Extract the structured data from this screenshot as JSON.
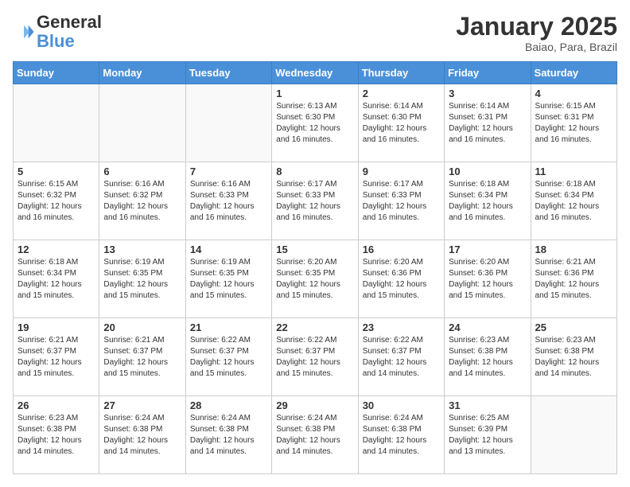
{
  "header": {
    "logo_line1": "General",
    "logo_line2": "Blue",
    "month": "January 2025",
    "location": "Baiao, Para, Brazil"
  },
  "weekdays": [
    "Sunday",
    "Monday",
    "Tuesday",
    "Wednesday",
    "Thursday",
    "Friday",
    "Saturday"
  ],
  "weeks": [
    [
      {
        "day": "",
        "info": ""
      },
      {
        "day": "",
        "info": ""
      },
      {
        "day": "",
        "info": ""
      },
      {
        "day": "1",
        "info": "Sunrise: 6:13 AM\nSunset: 6:30 PM\nDaylight: 12 hours\nand 16 minutes."
      },
      {
        "day": "2",
        "info": "Sunrise: 6:14 AM\nSunset: 6:30 PM\nDaylight: 12 hours\nand 16 minutes."
      },
      {
        "day": "3",
        "info": "Sunrise: 6:14 AM\nSunset: 6:31 PM\nDaylight: 12 hours\nand 16 minutes."
      },
      {
        "day": "4",
        "info": "Sunrise: 6:15 AM\nSunset: 6:31 PM\nDaylight: 12 hours\nand 16 minutes."
      }
    ],
    [
      {
        "day": "5",
        "info": "Sunrise: 6:15 AM\nSunset: 6:32 PM\nDaylight: 12 hours\nand 16 minutes."
      },
      {
        "day": "6",
        "info": "Sunrise: 6:16 AM\nSunset: 6:32 PM\nDaylight: 12 hours\nand 16 minutes."
      },
      {
        "day": "7",
        "info": "Sunrise: 6:16 AM\nSunset: 6:33 PM\nDaylight: 12 hours\nand 16 minutes."
      },
      {
        "day": "8",
        "info": "Sunrise: 6:17 AM\nSunset: 6:33 PM\nDaylight: 12 hours\nand 16 minutes."
      },
      {
        "day": "9",
        "info": "Sunrise: 6:17 AM\nSunset: 6:33 PM\nDaylight: 12 hours\nand 16 minutes."
      },
      {
        "day": "10",
        "info": "Sunrise: 6:18 AM\nSunset: 6:34 PM\nDaylight: 12 hours\nand 16 minutes."
      },
      {
        "day": "11",
        "info": "Sunrise: 6:18 AM\nSunset: 6:34 PM\nDaylight: 12 hours\nand 16 minutes."
      }
    ],
    [
      {
        "day": "12",
        "info": "Sunrise: 6:18 AM\nSunset: 6:34 PM\nDaylight: 12 hours\nand 15 minutes."
      },
      {
        "day": "13",
        "info": "Sunrise: 6:19 AM\nSunset: 6:35 PM\nDaylight: 12 hours\nand 15 minutes."
      },
      {
        "day": "14",
        "info": "Sunrise: 6:19 AM\nSunset: 6:35 PM\nDaylight: 12 hours\nand 15 minutes."
      },
      {
        "day": "15",
        "info": "Sunrise: 6:20 AM\nSunset: 6:35 PM\nDaylight: 12 hours\nand 15 minutes."
      },
      {
        "day": "16",
        "info": "Sunrise: 6:20 AM\nSunset: 6:36 PM\nDaylight: 12 hours\nand 15 minutes."
      },
      {
        "day": "17",
        "info": "Sunrise: 6:20 AM\nSunset: 6:36 PM\nDaylight: 12 hours\nand 15 minutes."
      },
      {
        "day": "18",
        "info": "Sunrise: 6:21 AM\nSunset: 6:36 PM\nDaylight: 12 hours\nand 15 minutes."
      }
    ],
    [
      {
        "day": "19",
        "info": "Sunrise: 6:21 AM\nSunset: 6:37 PM\nDaylight: 12 hours\nand 15 minutes."
      },
      {
        "day": "20",
        "info": "Sunrise: 6:21 AM\nSunset: 6:37 PM\nDaylight: 12 hours\nand 15 minutes."
      },
      {
        "day": "21",
        "info": "Sunrise: 6:22 AM\nSunset: 6:37 PM\nDaylight: 12 hours\nand 15 minutes."
      },
      {
        "day": "22",
        "info": "Sunrise: 6:22 AM\nSunset: 6:37 PM\nDaylight: 12 hours\nand 15 minutes."
      },
      {
        "day": "23",
        "info": "Sunrise: 6:22 AM\nSunset: 6:37 PM\nDaylight: 12 hours\nand 14 minutes."
      },
      {
        "day": "24",
        "info": "Sunrise: 6:23 AM\nSunset: 6:38 PM\nDaylight: 12 hours\nand 14 minutes."
      },
      {
        "day": "25",
        "info": "Sunrise: 6:23 AM\nSunset: 6:38 PM\nDaylight: 12 hours\nand 14 minutes."
      }
    ],
    [
      {
        "day": "26",
        "info": "Sunrise: 6:23 AM\nSunset: 6:38 PM\nDaylight: 12 hours\nand 14 minutes."
      },
      {
        "day": "27",
        "info": "Sunrise: 6:24 AM\nSunset: 6:38 PM\nDaylight: 12 hours\nand 14 minutes."
      },
      {
        "day": "28",
        "info": "Sunrise: 6:24 AM\nSunset: 6:38 PM\nDaylight: 12 hours\nand 14 minutes."
      },
      {
        "day": "29",
        "info": "Sunrise: 6:24 AM\nSunset: 6:38 PM\nDaylight: 12 hours\nand 14 minutes."
      },
      {
        "day": "30",
        "info": "Sunrise: 6:24 AM\nSunset: 6:38 PM\nDaylight: 12 hours\nand 14 minutes."
      },
      {
        "day": "31",
        "info": "Sunrise: 6:25 AM\nSunset: 6:39 PM\nDaylight: 12 hours\nand 13 minutes."
      },
      {
        "day": "",
        "info": ""
      }
    ]
  ]
}
